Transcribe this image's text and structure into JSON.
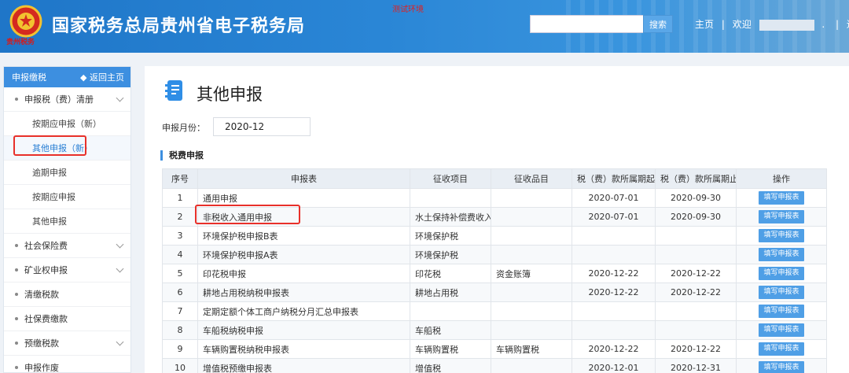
{
  "header": {
    "title": "国家税务总局贵州省电子税务局",
    "emblem_text": "贵州税务",
    "env_label": "测试环境",
    "search_placeholder": "",
    "search_label": "搜索",
    "home_label": "主页",
    "separator": "|",
    "welcome_label": "欢迎",
    "dot": ".",
    "logout_label": "退出"
  },
  "sidebar": {
    "header_label": "申报缴税",
    "back_label": "◆ 返回主页",
    "items": [
      {
        "label": "申报税（费）清册"
      },
      {
        "label": "按期应申报（新）"
      },
      {
        "label": "其他申报（新）"
      },
      {
        "label": "逾期申报"
      },
      {
        "label": "按期应申报"
      },
      {
        "label": "其他申报"
      },
      {
        "label": "社会保险费"
      },
      {
        "label": "矿业权申报"
      },
      {
        "label": "清缴税款"
      },
      {
        "label": "社保费缴款"
      },
      {
        "label": "预缴税款"
      },
      {
        "label": "申报作废"
      }
    ]
  },
  "main": {
    "title": "其他申报",
    "month_label": "申报月份：",
    "month_value": "2020-12",
    "section_title": "税费申报",
    "columns": [
      "序号",
      "申报表",
      "征收项目",
      "征收品目",
      "税（费）款所属期起",
      "税（费）款所属期止",
      "操作"
    ],
    "action_label": "填写申报表",
    "rows": [
      {
        "no": "1",
        "form": "通用申报",
        "item": "",
        "sub": "",
        "start": "2020-07-01",
        "end": "2020-09-30"
      },
      {
        "no": "2",
        "form": "非税收入通用申报",
        "item": "水土保持补偿费收入",
        "sub": "",
        "start": "2020-07-01",
        "end": "2020-09-30"
      },
      {
        "no": "3",
        "form": "环境保护税申报B表",
        "item": "环境保护税",
        "sub": "",
        "start": "",
        "end": ""
      },
      {
        "no": "4",
        "form": "环境保护税申报A表",
        "item": "环境保护税",
        "sub": "",
        "start": "",
        "end": ""
      },
      {
        "no": "5",
        "form": "印花税申报",
        "item": "印花税",
        "sub": "资金账簿",
        "start": "2020-12-22",
        "end": "2020-12-22"
      },
      {
        "no": "6",
        "form": "耕地占用税纳税申报表",
        "item": "耕地占用税",
        "sub": "",
        "start": "2020-12-22",
        "end": "2020-12-22"
      },
      {
        "no": "7",
        "form": "定期定额个体工商户纳税分月汇总申报表",
        "item": "",
        "sub": "",
        "start": "",
        "end": ""
      },
      {
        "no": "8",
        "form": "车船税纳税申报",
        "item": "车船税",
        "sub": "",
        "start": "",
        "end": ""
      },
      {
        "no": "9",
        "form": "车辆购置税纳税申报表",
        "item": "车辆购置税",
        "sub": "车辆购置税",
        "start": "2020-12-22",
        "end": "2020-12-22"
      },
      {
        "no": "10",
        "form": "增值税预缴申报表",
        "item": "增值税",
        "sub": "",
        "start": "2020-12-01",
        "end": "2020-12-31"
      }
    ]
  },
  "colors": {
    "header": "#2a86d6",
    "accent": "#3d8fe0",
    "highlight": "#e8302a"
  }
}
